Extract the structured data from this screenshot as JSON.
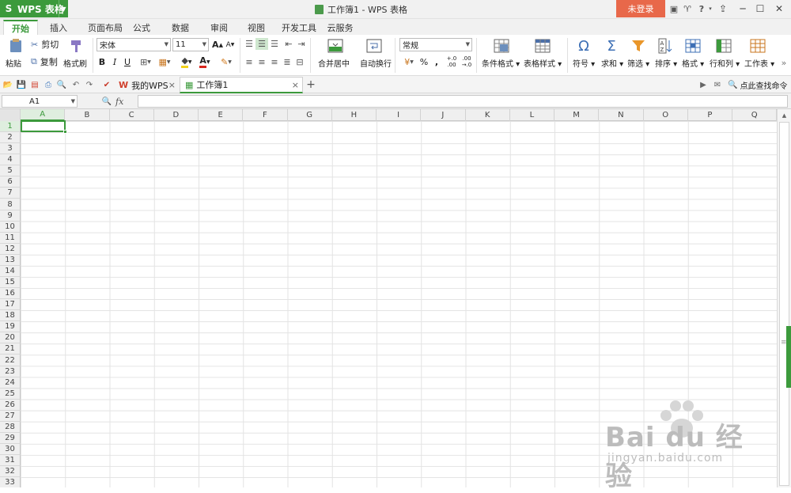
{
  "app": {
    "logo": "S",
    "menu_label": "WPS 表格"
  },
  "window": {
    "title": "工作簿1 - WPS 表格"
  },
  "login_button": "未登录",
  "help_label": "?",
  "tabs": [
    "开始",
    "插入",
    "页面布局",
    "公式",
    "数据",
    "审阅",
    "视图",
    "开发工具",
    "云服务"
  ],
  "active_tab": "开始",
  "ribbon": {
    "paste": "粘贴",
    "cut": "剪切",
    "copy": "复制",
    "format_painter": "格式刷",
    "font_name": "宋体",
    "font_size": "11",
    "bold": "B",
    "italic": "I",
    "underline": "U",
    "merge_center": "合并居中",
    "wrap_text": "自动换行",
    "number_format": "常规",
    "percent": "%",
    "comma": ",",
    "dec_inc": "+.0 .00",
    "dec_dec": ".00 →.0",
    "cond_format": "条件格式",
    "table_style": "表格样式",
    "symbol": "符号",
    "sum": "求和",
    "filter": "筛选",
    "sort": "排序",
    "format": "格式",
    "row_col": "行和列",
    "worksheet": "工作表"
  },
  "doc_tabs": [
    {
      "label": "我的WPS",
      "close": "×"
    },
    {
      "label": "工作簿1",
      "close": "×"
    }
  ],
  "new_tab": "+",
  "search_cmd": "点此查找命令",
  "name_box": "A1",
  "fx": "fx",
  "columns": [
    "A",
    "B",
    "C",
    "D",
    "E",
    "F",
    "G",
    "H",
    "I",
    "J",
    "K",
    "L",
    "M",
    "N",
    "O",
    "P",
    "Q"
  ],
  "rows": [
    "1",
    "2",
    "3",
    "4",
    "5",
    "6",
    "7",
    "8",
    "9",
    "10",
    "11",
    "12",
    "13",
    "14",
    "15",
    "16",
    "17",
    "18",
    "19",
    "20",
    "21",
    "22",
    "23",
    "24",
    "25",
    "26",
    "27",
    "28",
    "29",
    "30",
    "31",
    "32",
    "33"
  ],
  "selected_cell": "A1",
  "watermark": {
    "line1": "Bai du 经验",
    "line2": "jingyan.baidu.com"
  },
  "colors": {
    "accent": "#3c9a3c",
    "login": "#e8684a"
  }
}
